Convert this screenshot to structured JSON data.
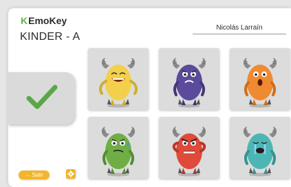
{
  "app": {
    "logo_k": "K",
    "logo_text": "EmoKey"
  },
  "header": {
    "group_title": "KINDER - A",
    "user_name": "Nicolás Larraín"
  },
  "sidebar": {
    "confirm_icon": "checkmark-icon",
    "exit_label": "← Salir",
    "settings_icon": "gear-icon"
  },
  "emotions": [
    {
      "id": "happy",
      "color": "#f2d04c",
      "dark": "#cfae2d"
    },
    {
      "id": "sad",
      "color": "#5c4a9b",
      "dark": "#463679"
    },
    {
      "id": "surprised",
      "color": "#f08a32",
      "dark": "#cf6e1a"
    },
    {
      "id": "disgusted",
      "color": "#6fae45",
      "dark": "#558c31"
    },
    {
      "id": "angry",
      "color": "#e04a3a",
      "dark": "#b9362a"
    },
    {
      "id": "crying",
      "color": "#4db6b4",
      "dark": "#379391"
    }
  ]
}
